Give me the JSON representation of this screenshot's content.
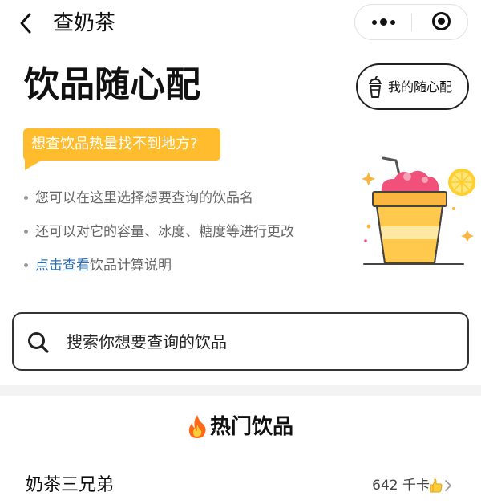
{
  "nav": {
    "title": "查奶茶",
    "back_icon": "chevron-left-icon",
    "more_icon": "more-dots-icon",
    "close_icon": "target-close-icon"
  },
  "header": {
    "title": "饮品随心配",
    "my_button_label": "我的随心配",
    "my_button_icon": "cup-icon"
  },
  "intro": {
    "bubble_text": "想查饮品热量找不到地方?",
    "tips": [
      "您可以在这里选择想要查询的饮品名",
      "还可以对它的容量、冰度、糖度等进行更改"
    ],
    "link_text": "点击查看",
    "link_suffix": "饮品计算说明"
  },
  "search": {
    "placeholder": "搜索你想要查询的饮品",
    "icon": "search-icon"
  },
  "hot": {
    "title": "热门饮品",
    "items": [
      {
        "name": "奶茶三兄弟",
        "calories": "642 千卡"
      }
    ]
  },
  "colors": {
    "accent_yellow": "#ffbd2e",
    "link_blue": "#2a6fb5",
    "cup_orange": "#f9b640",
    "drink_pink": "#f0507a"
  }
}
